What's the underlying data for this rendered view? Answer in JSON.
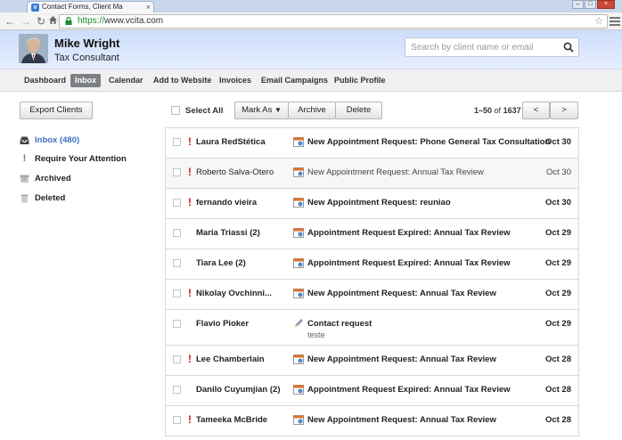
{
  "browser": {
    "tab_title": "Contact Forms, Client Ma",
    "url_scheme": "https://",
    "url_host": "www.vcita.com"
  },
  "header": {
    "user_name": "Mike Wright",
    "user_title": "Tax Consultant",
    "search_placeholder": "Search by client name or email",
    "search_value": ""
  },
  "nav": {
    "dashboard": "Dashboard",
    "inbox": "Inbox",
    "calendar": "Calendar",
    "add_to_website": "Add to Website",
    "invoices": "Invoices",
    "email_campaigns": "Email Campaigns",
    "public_profile": "Public Profile"
  },
  "actions": {
    "export_clients": "Export Clients",
    "select_all": "Select All",
    "mark_as": "Mark As",
    "archive": "Archive",
    "delete": "Delete",
    "pager_range": "1–50",
    "pager_of": "of",
    "pager_total": "1637",
    "prev": "<",
    "next": ">"
  },
  "sidebar": {
    "inbox": "Inbox (480)",
    "attention": "Require Your Attention",
    "archived": "Archived",
    "deleted": "Deleted"
  },
  "messages": [
    {
      "sender": "Laura RedStética",
      "subject": "New Appointment Request: Phone General Tax Consultation",
      "preview": "",
      "date": "Oct 30"
    },
    {
      "sender": "Roberto Salva-Otero",
      "subject": "New Appointment Request: Annual Tax Review",
      "preview": "",
      "date": "Oct 30"
    },
    {
      "sender": "fernando vieira",
      "subject": "New Appointment Request: reuniao",
      "preview": "",
      "date": "Oct 30"
    },
    {
      "sender": "Maria Triassi (2)",
      "subject": "Appointment Request Expired: Annual Tax Review",
      "preview": "",
      "date": "Oct 29"
    },
    {
      "sender": "Tiara Lee (2)",
      "subject": "Appointment Request Expired: Annual Tax Review",
      "preview": "",
      "date": "Oct 29"
    },
    {
      "sender": "Nikolay Ovchinni...",
      "subject": "New Appointment Request: Annual Tax Review",
      "preview": "",
      "date": "Oct 29"
    },
    {
      "sender": "Flavio Pioker",
      "subject": "Contact request",
      "preview": "teste",
      "date": "Oct 29"
    },
    {
      "sender": "Lee Chamberlain",
      "subject": "New Appointment Request: Annual Tax Review",
      "preview": "",
      "date": "Oct 28"
    },
    {
      "sender": "Danilo Cuyumjian (2)",
      "subject": "Appointment Request Expired: Annual Tax Review",
      "preview": "",
      "date": "Oct 28"
    },
    {
      "sender": "Tameeka McBride",
      "subject": "New Appointment Request: Annual Tax Review",
      "preview": "",
      "date": "Oct 28"
    }
  ],
  "colors": {
    "header_bg": "#cdddfb",
    "nav_active_bg": "#7c7f84",
    "flag_red": "#d21b1b",
    "link_blue": "#3a6fc4",
    "https_green": "#1a8d2a"
  }
}
